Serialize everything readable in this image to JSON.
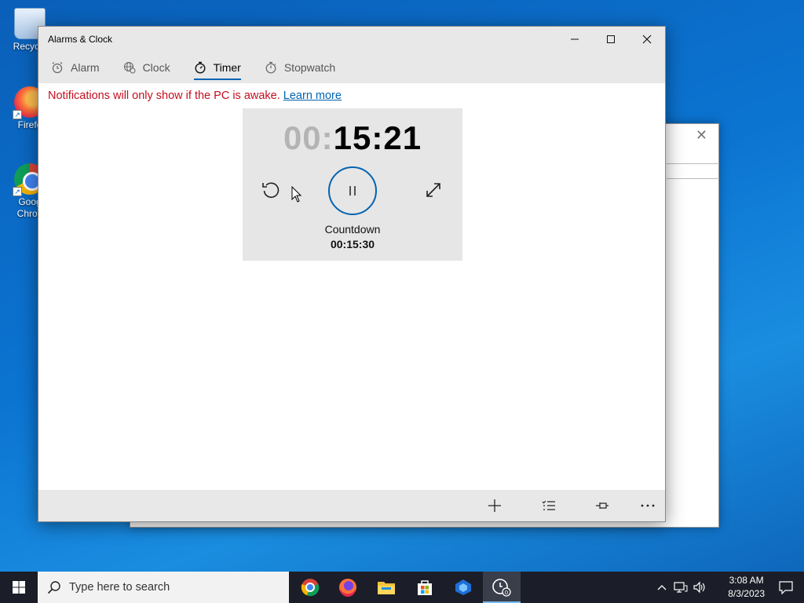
{
  "desktop": {
    "icons": [
      {
        "label": "Recycle Bin",
        "visible_label": "Recycle",
        "icon": "recycle-bin-icon"
      },
      {
        "label": "Firefox",
        "visible_label": "Firefo",
        "icon": "firefox-icon"
      },
      {
        "label": "Google Chrome",
        "visible_label_line1": "Goog",
        "visible_label_line2": "Chron",
        "icon": "chrome-icon"
      }
    ]
  },
  "window": {
    "title": "Alarms & Clock",
    "controls": {
      "minimize": "minimize-icon",
      "maximize": "maximize-icon",
      "close": "close-icon"
    }
  },
  "tabs": [
    {
      "label": "Alarm",
      "icon": "alarm-icon",
      "active": false
    },
    {
      "label": "Clock",
      "icon": "globe-clock-icon",
      "active": false
    },
    {
      "label": "Timer",
      "icon": "timer-icon",
      "active": true
    },
    {
      "label": "Stopwatch",
      "icon": "stopwatch-icon",
      "active": false
    }
  ],
  "notice": {
    "text": "Notifications will only show if the PC is awake.",
    "link": "Learn more"
  },
  "timer": {
    "hours": "00:",
    "remaining": "15:21",
    "label": "Countdown",
    "total": "00:15:30",
    "controls": [
      "reset-icon",
      "pause-icon",
      "expand-icon"
    ]
  },
  "command_bar": [
    "add-icon",
    "select-list-icon",
    "pin-icon",
    "more-icon"
  ],
  "taskbar": {
    "search_placeholder": "Type here to search",
    "apps": [
      "chrome-icon",
      "firefox-icon",
      "file-explorer-icon",
      "microsoft-store-icon",
      "app-icon",
      "alarms-clock-icon"
    ],
    "time": "3:08 AM",
    "date": "8/3/2023"
  },
  "colors": {
    "accent": "#0063b1",
    "notice_text": "#c50f1f",
    "dim_digits": "#b4b4b4",
    "desktop": "#0b74d1",
    "taskbar": "#1b1d28"
  }
}
